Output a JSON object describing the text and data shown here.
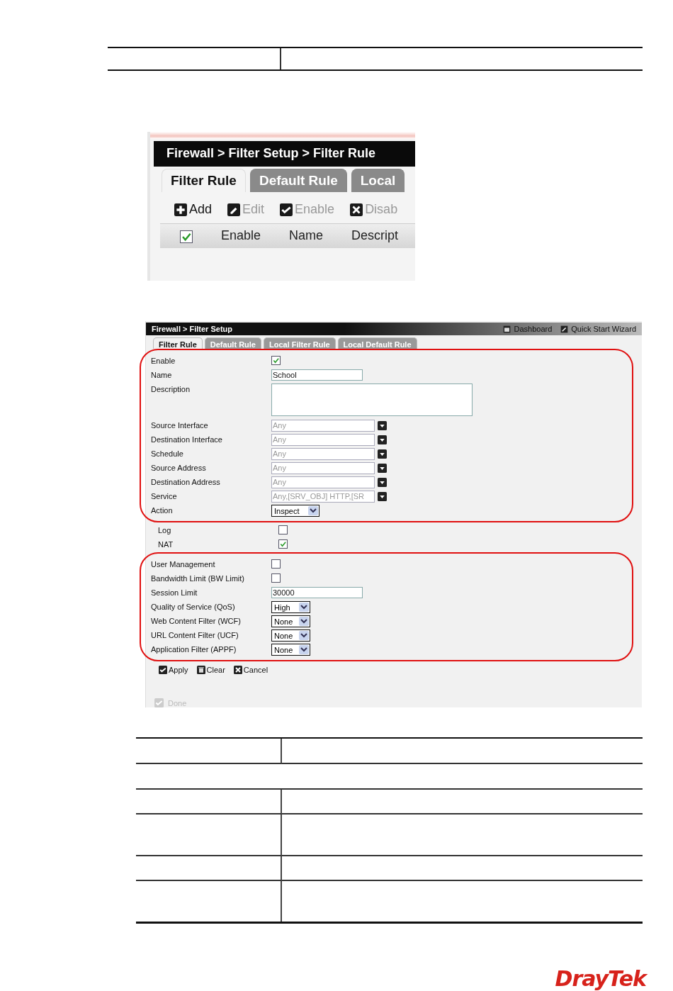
{
  "overview_screenshot": {
    "breadcrumb": "Firewall > Filter Setup > Filter Rule",
    "tabs": [
      {
        "label": "Filter Rule",
        "selected": true
      },
      {
        "label": "Default Rule",
        "selected": false
      },
      {
        "label": "Local",
        "selected": false
      }
    ],
    "toolbar": [
      {
        "kind": "add",
        "label": "Add",
        "disabled": false
      },
      {
        "kind": "edit",
        "label": "Edit",
        "disabled": true
      },
      {
        "kind": "enable",
        "label": "Enable",
        "disabled": true
      },
      {
        "kind": "disable",
        "label": "Disab",
        "disabled": true
      }
    ],
    "select_all_checked": true,
    "columns": [
      "Enable",
      "Name",
      "Descript"
    ]
  },
  "edit_screenshot": {
    "breadcrumb": "Firewall > Filter Setup",
    "header_links": [
      {
        "kind": "dashboard",
        "label": "Dashboard"
      },
      {
        "kind": "wizard",
        "label": "Quick Start Wizard"
      }
    ],
    "tabs": [
      {
        "label": "Filter Rule",
        "selected": true
      },
      {
        "label": "Default Rule",
        "selected": false
      },
      {
        "label": "Local Filter Rule",
        "selected": false
      },
      {
        "label": "Local Default Rule",
        "selected": false
      }
    ],
    "sections": [
      {
        "highlighted": true,
        "fields": [
          {
            "kind": "checkbox",
            "label": "Enable",
            "checked": true
          },
          {
            "kind": "text",
            "label": "Name",
            "value": "School"
          },
          {
            "kind": "textarea",
            "label": "Description"
          },
          {
            "kind": "picker",
            "label": "Source Interface",
            "value": "Any"
          },
          {
            "kind": "picker",
            "label": "Destination Interface",
            "value": "Any"
          },
          {
            "kind": "picker",
            "label": "Schedule",
            "value": "Any"
          },
          {
            "kind": "picker",
            "label": "Source Address",
            "value": "Any"
          },
          {
            "kind": "picker",
            "label": "Destination Address",
            "value": "Any"
          },
          {
            "kind": "picker",
            "label": "Service",
            "value": "Any,[SRV_OBJ] HTTP,[SR"
          },
          {
            "kind": "select",
            "label": "Action",
            "value": "Inspect"
          }
        ]
      },
      {
        "highlighted": false,
        "fields": [
          {
            "kind": "checkbox",
            "label": "Log",
            "checked": false
          },
          {
            "kind": "checkbox",
            "label": "NAT",
            "checked": true
          }
        ]
      },
      {
        "highlighted": true,
        "fields": [
          {
            "kind": "checkbox",
            "label": "User Management",
            "checked": false
          },
          {
            "kind": "checkbox",
            "label": "Bandwidth Limit (BW Limit)",
            "checked": false
          },
          {
            "kind": "text",
            "label": "Session Limit",
            "value": "30000"
          },
          {
            "kind": "select",
            "label": "Quality of Service (QoS)",
            "value": "High"
          },
          {
            "kind": "select",
            "label": "Web Content Filter (WCF)",
            "value": "None"
          },
          {
            "kind": "select",
            "label": "URL Content Filter (UCF)",
            "value": "None"
          },
          {
            "kind": "select",
            "label": "Application Filter (APPF)",
            "value": "None"
          }
        ]
      }
    ],
    "buttons": [
      {
        "kind": "apply",
        "label": "Apply"
      },
      {
        "kind": "clear",
        "label": "Clear"
      },
      {
        "kind": "cancel",
        "label": "Cancel"
      }
    ],
    "status": "Done"
  },
  "logo": "DrayTek"
}
